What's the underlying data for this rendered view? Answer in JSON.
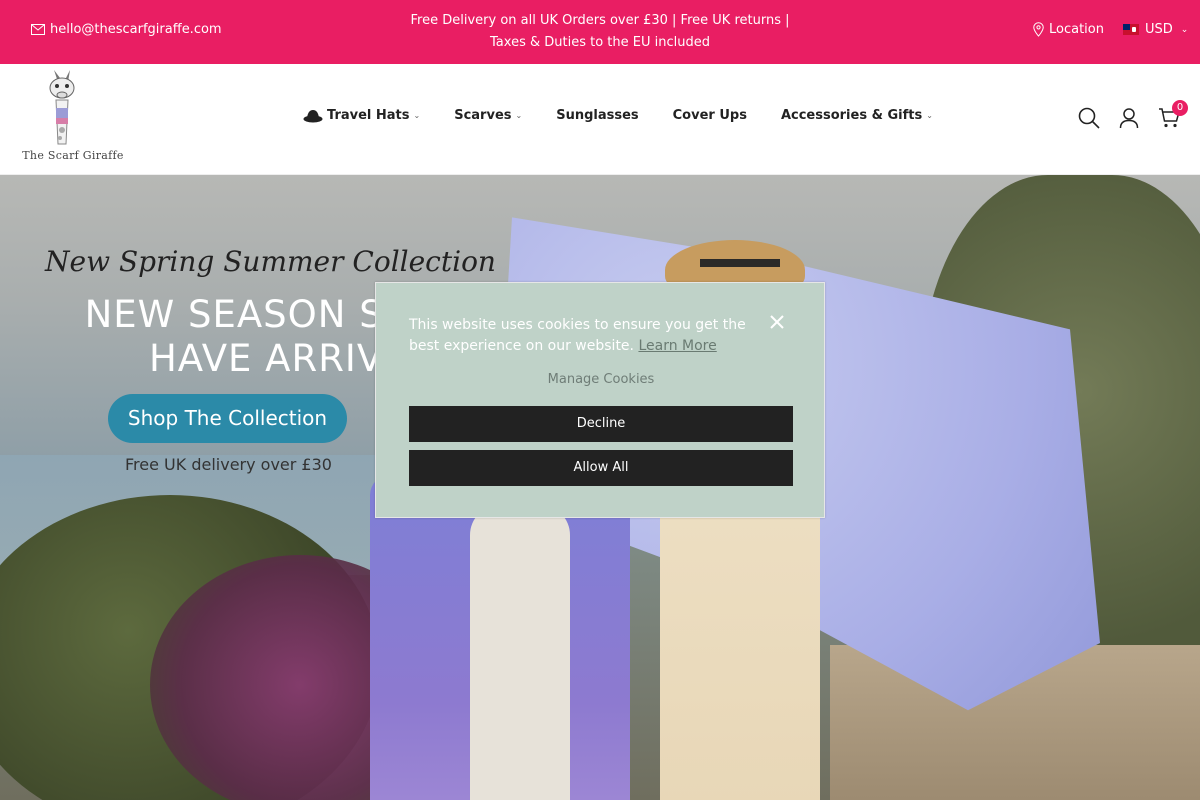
{
  "topbar": {
    "email": "hello@thescarfgiraffe.com",
    "promo_line1": "Free Delivery on all UK Orders over £30 | Free UK returns |",
    "promo_line2": "Taxes & Duties to the EU included",
    "location": "Location",
    "currency": "USD",
    "bg_color": "#e91e63"
  },
  "header": {
    "logo_text": "The Scarf Giraffe",
    "nav": [
      {
        "label": "Travel Hats",
        "has_dropdown": true,
        "icon": "hat-icon"
      },
      {
        "label": "Scarves",
        "has_dropdown": true
      },
      {
        "label": "Sunglasses",
        "has_dropdown": false
      },
      {
        "label": "Cover Ups",
        "has_dropdown": false
      },
      {
        "label": "Accessories & Gifts",
        "has_dropdown": true
      }
    ],
    "icons": [
      "search-icon",
      "account-icon",
      "cart-icon"
    ],
    "cart_count": "0"
  },
  "hero": {
    "title": "New Spring Summer Collection",
    "headline_line1": "NEW SEASON STYLES",
    "headline_line2": "HAVE ARRIVED",
    "button": "Shop The Collection",
    "subtext": "Free UK delivery over £30",
    "button_color": "#2b8aa8"
  },
  "cookie": {
    "message": "This website uses cookies to ensure you get the best experience on our website.",
    "learn_more": "Learn More",
    "manage": "Manage Cookies",
    "decline": "Decline",
    "allow": "Allow All",
    "bg_color": "#bfd2c8"
  }
}
